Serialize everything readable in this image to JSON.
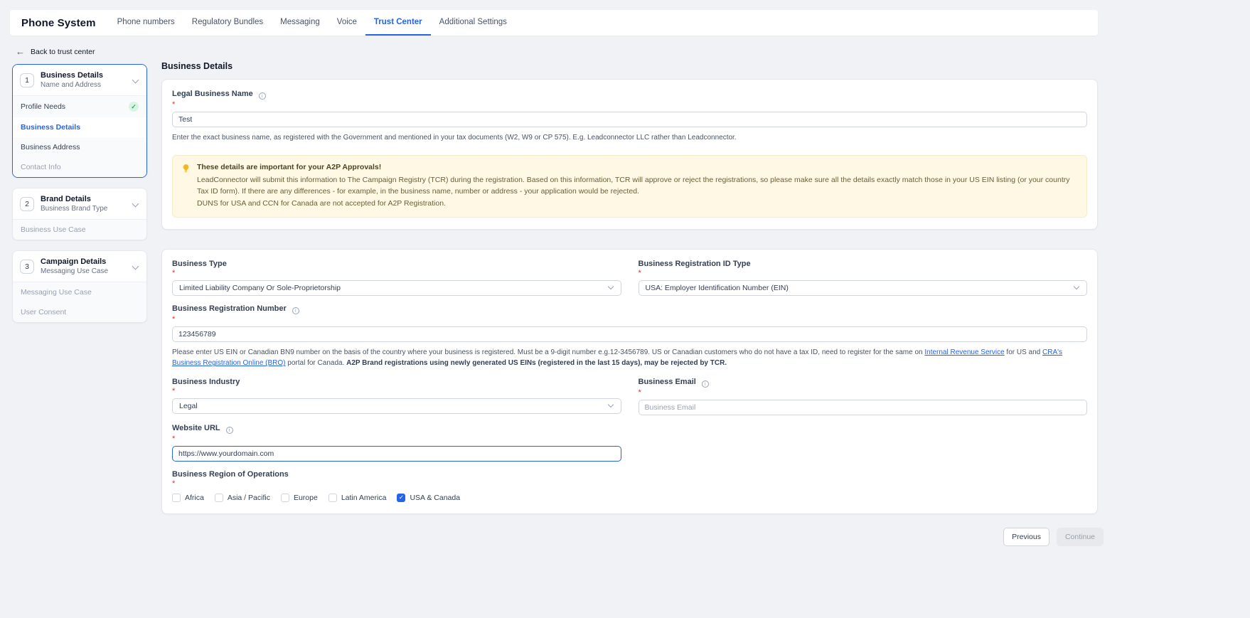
{
  "colors": {
    "accent": "#2563eb",
    "warning_bg": "#fff8e4",
    "success": "#12b76a"
  },
  "topbar": {
    "title": "Phone System",
    "tabs": [
      {
        "label": "Phone numbers",
        "active": false
      },
      {
        "label": "Regulatory Bundles",
        "active": false
      },
      {
        "label": "Messaging",
        "active": false
      },
      {
        "label": "Voice",
        "active": false
      },
      {
        "label": "Trust Center",
        "active": true
      },
      {
        "label": "Additional Settings",
        "active": false
      }
    ]
  },
  "back_link": {
    "label": "Back to trust center"
  },
  "ui": {
    "required": "*",
    "info": "i",
    "check": "✓"
  },
  "sidebar": {
    "sections": [
      {
        "number": "1",
        "title": "Business Details",
        "subtitle": "Name and Address",
        "items": [
          {
            "label": "Profile Needs",
            "state": "done"
          },
          {
            "label": "Business Details",
            "state": "current"
          },
          {
            "label": "Business Address",
            "state": "normal"
          },
          {
            "label": "Contact Info",
            "state": "disabled"
          }
        ]
      },
      {
        "number": "2",
        "title": "Brand Details",
        "subtitle": "Business Brand Type",
        "items": [
          {
            "label": "Business Use Case",
            "state": "disabled"
          }
        ]
      },
      {
        "number": "3",
        "title": "Campaign Details",
        "subtitle": "Messaging Use Case",
        "items": [
          {
            "label": "Messaging Use Case",
            "state": "disabled"
          },
          {
            "label": "User Consent",
            "state": "disabled"
          }
        ]
      }
    ]
  },
  "main": {
    "heading": "Business Details",
    "legal_business_name": {
      "label": "Legal Business Name",
      "value": "Test",
      "helper": "Enter the exact business name, as registered with the Government and mentioned in your tax documents (W2, W9 or CP 575). E.g. Leadconnector LLC rather than Leadconnector."
    },
    "warning": {
      "title": "These details are important for your A2P Approvals!",
      "body": "LeadConnector will submit this information to The Campaign Registry (TCR) during the registration. Based on this information, TCR will approve or reject the registrations, so please make sure all the details exactly match those in your US EIN listing (or your country Tax ID form). If there are any differences - for example, in the business name, number or address - your application would be rejected.",
      "note": "DUNS for USA and CCN for Canada are not accepted for A2P Registration."
    },
    "business_type": {
      "label": "Business Type",
      "value": "Limited Liability Company Or Sole-Proprietorship"
    },
    "business_registration_id_type": {
      "label": "Business Registration ID Type",
      "value": "USA: Employer Identification Number (EIN)"
    },
    "business_registration_number": {
      "label": "Business Registration Number",
      "value": "123456789",
      "helper": {
        "pre": "Please enter US EIN or Canadian BN9 number on the basis of the country where your business is registered. Must be a 9-digit number e.g.12-3456789. US or Canadian customers who do not have a tax ID, need to register for the same on ",
        "link1": "Internal Revenue Service",
        "mid": " for US and ",
        "link2": "CRA's Business Registration Online (BRO)",
        "post": " portal for Canada. ",
        "bold": "A2P Brand registrations using newly generated US EINs (registered in the last 15 days), may be rejected by TCR."
      }
    },
    "business_industry": {
      "label": "Business Industry",
      "value": "Legal"
    },
    "business_email": {
      "label": "Business Email",
      "placeholder": "Business Email"
    },
    "website_url": {
      "label": "Website URL",
      "value": "https://www.yourdomain.com"
    },
    "business_region": {
      "label": "Business Region of Operations",
      "options": [
        {
          "label": "Africa",
          "checked": false
        },
        {
          "label": "Asia / Pacific",
          "checked": false
        },
        {
          "label": "Europe",
          "checked": false
        },
        {
          "label": "Latin America",
          "checked": false
        },
        {
          "label": "USA & Canada",
          "checked": true
        }
      ]
    }
  },
  "footer": {
    "previous_label": "Previous",
    "continue_label": "Continue"
  }
}
